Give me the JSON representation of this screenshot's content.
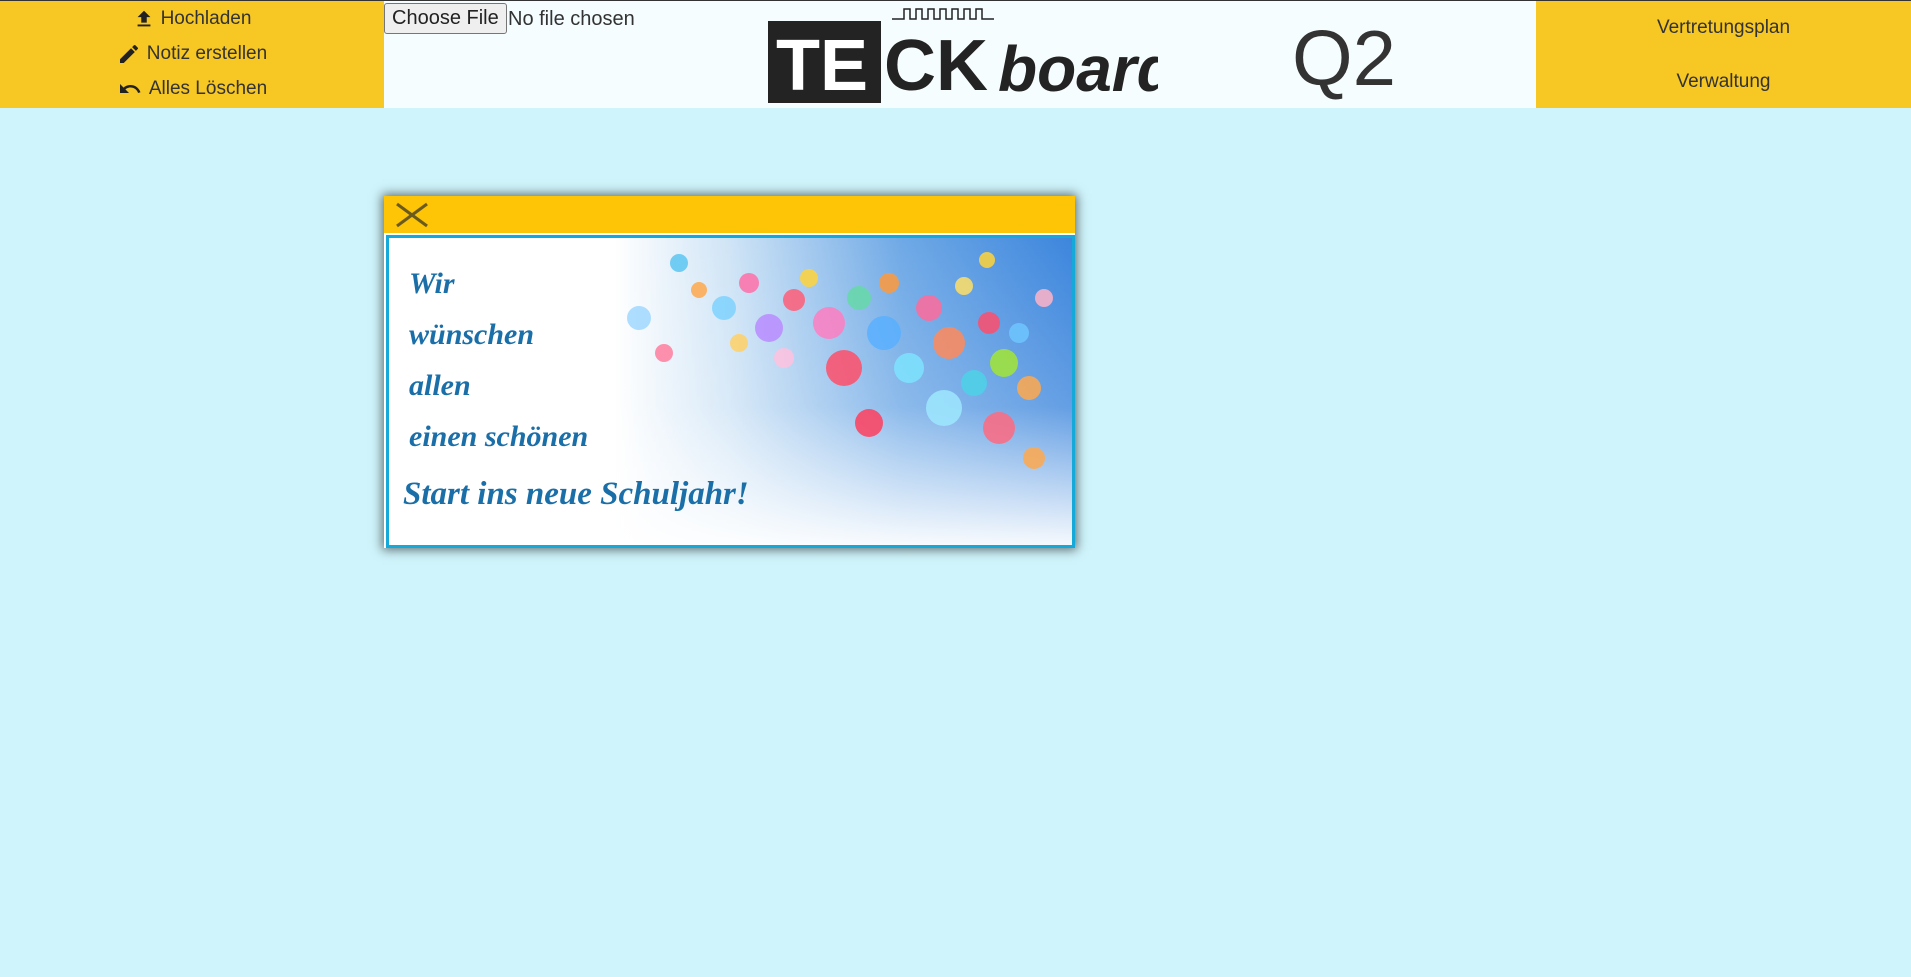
{
  "menu": {
    "upload": "Hochladen",
    "note": "Notiz erstellen",
    "clear": "Alles Löschen"
  },
  "file_input": {
    "button": "Choose File",
    "status": "No file chosen"
  },
  "logo": {
    "part1": "TE",
    "part2": "CK",
    "part3": "board"
  },
  "class_label": "Q2",
  "right_menu": {
    "plan": "Vertretungsplan",
    "admin": "Verwaltung"
  },
  "widget": {
    "image_lines": [
      "Wir",
      "wünschen",
      "allen",
      "einen schönen",
      "Start ins neue Schuljahr!"
    ]
  },
  "icons": {
    "upload": "upload-icon",
    "note": "pencil-icon",
    "clear": "undo-icon",
    "close": "close-icon"
  },
  "colors": {
    "background": "#cff4fb",
    "menu": "#f7c723",
    "header": "#fdc505",
    "image_border": "#14a9d8"
  }
}
